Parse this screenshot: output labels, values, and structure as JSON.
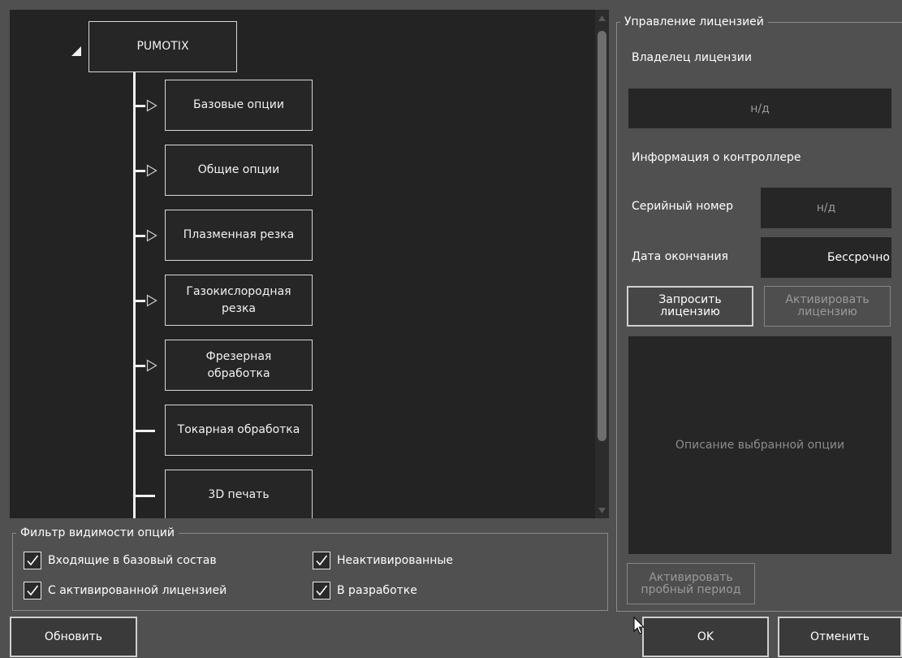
{
  "tree": {
    "root": {
      "label": "PUMOTIX",
      "icon": "collapse-triangle-icon"
    },
    "children": [
      {
        "label": "Базовые опции",
        "has_children": true
      },
      {
        "label": "Общие опции",
        "has_children": true
      },
      {
        "label": "Плазменная резка",
        "has_children": true
      },
      {
        "label": "Газокислородная резка",
        "has_children": true
      },
      {
        "label": "Фрезерная обработка",
        "has_children": true
      },
      {
        "label": "Токарная обработка",
        "has_children": false
      },
      {
        "label": "3D печать",
        "has_children": false
      }
    ]
  },
  "filter": {
    "title": "Фильтр видимости опций",
    "options": [
      {
        "label": "Входящие в базовый состав",
        "checked": true
      },
      {
        "label": "Неактивированные",
        "checked": true
      },
      {
        "label": "С активированной лицензией",
        "checked": true
      },
      {
        "label": "В разработке",
        "checked": true
      }
    ]
  },
  "license": {
    "title": "Управление лицензией",
    "owner_label": "Владелец лицензии",
    "owner_value": "н/д",
    "controller_info_label": "Информация о контроллере",
    "serial_label": "Серийный номер",
    "serial_value": "н/д",
    "expiry_label": "Дата окончания",
    "expiry_value": "Бессрочно",
    "request_button": "Запросить лицензию",
    "activate_button": "Активировать лицензию",
    "description_placeholder": "Описание выбранной опции",
    "trial_button": "Активировать пробный период"
  },
  "buttons": {
    "refresh": "Обновить",
    "ok": "OK",
    "cancel": "Отменить"
  },
  "colors": {
    "background": "#505050",
    "panel": "#232323",
    "border": "#d8d8d8",
    "disabled_text": "#9a9a9a"
  }
}
